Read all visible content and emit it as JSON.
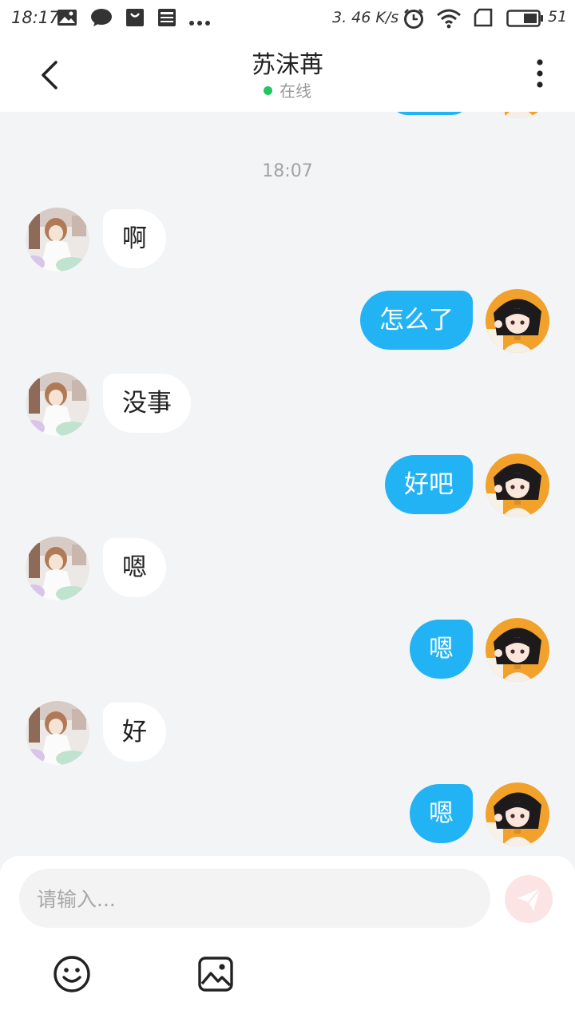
{
  "status_bar": {
    "time": "18:17",
    "net_speed": "3. 46 K/s",
    "battery": "51",
    "icons": [
      "image-notification-icon",
      "message-notification-icon",
      "shopping-bag-icon",
      "news-icon",
      "more-notifications-icon",
      "alarm-icon",
      "wifi-icon",
      "sim-icon",
      "battery-icon"
    ]
  },
  "header": {
    "title": "苏沫苒",
    "status": "在线",
    "status_color": "#22c55e",
    "back_icon": "chevron-left-icon",
    "more_icon": "more-vertical-icon"
  },
  "chat": {
    "timestamp": "18:07",
    "messages": [
      {
        "from": "other",
        "text": "啊"
      },
      {
        "from": "me",
        "text": "怎么了"
      },
      {
        "from": "other",
        "text": "没事"
      },
      {
        "from": "me",
        "text": "好吧"
      },
      {
        "from": "other",
        "text": "嗯"
      },
      {
        "from": "me",
        "text": "嗯"
      },
      {
        "from": "other",
        "text": "好"
      },
      {
        "from": "me",
        "text": "嗯"
      }
    ]
  },
  "input": {
    "placeholder": "请输入...",
    "value": "",
    "send_icon": "send-icon",
    "emoji_icon": "emoji-icon",
    "image_icon": "image-icon"
  },
  "colors": {
    "outgoing_bubble": "#22b3f5",
    "incoming_bubble": "#ffffff",
    "background": "#f3f4f6",
    "send_button": "#fde4e4"
  }
}
